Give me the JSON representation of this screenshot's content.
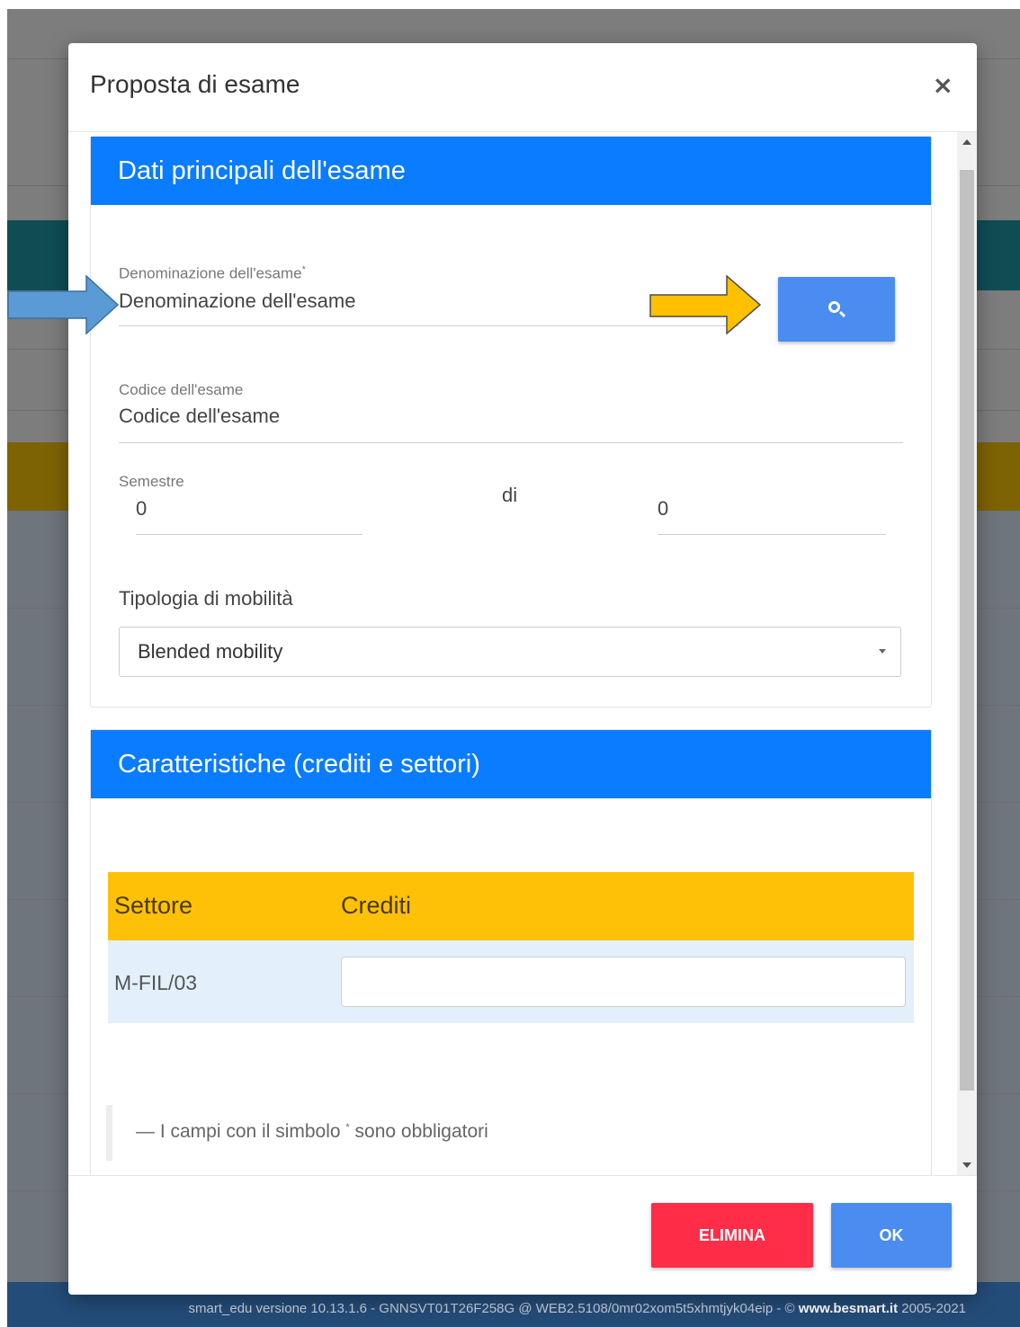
{
  "dialog": {
    "title": "Proposta di esame",
    "close_symbol": "×"
  },
  "section_main": {
    "title": "Dati principali dell'esame",
    "exam_name": {
      "label": "Denominazione dell'esame",
      "required_mark": "*",
      "placeholder": "Denominazione dell'esame"
    },
    "exam_code": {
      "label": "Codice dell'esame",
      "placeholder": "Codice dell'esame"
    },
    "semester": {
      "label": "Semestre",
      "value": "0",
      "separator": "di",
      "total": "0"
    },
    "mobility": {
      "label": "Tipologia di mobilità",
      "selected": "Blended mobility"
    }
  },
  "section_features": {
    "title": "Caratteristiche (crediti e settori)",
    "table": {
      "columns": [
        "Settore",
        "Crediti"
      ],
      "rows": [
        {
          "sector": "M-FIL/03",
          "credits": ""
        }
      ]
    }
  },
  "note": {
    "prefix": "— I campi con il simbolo",
    "symbol": "*",
    "suffix": "sono obbligatori"
  },
  "footer_buttons": {
    "delete_label": "ELIMINA",
    "ok_label": "OK"
  },
  "page_footer": {
    "text": "smart_edu versione 10.13.1.6 - GNNSVT01T26F258G @ WEB2.5108/0mr02xom5t5xhmtjyk04eip - ©",
    "link": "www.besmart.it",
    "years": "2005-2021"
  },
  "colors": {
    "section_header": "#0a7cff",
    "table_header": "#ffc107",
    "table_row": "#e3f0fb",
    "search_button": "#4a8cf0",
    "delete_button": "#ff2d47",
    "ok_button": "#4a8cf0",
    "arrow_blue": "#5b9bd5",
    "arrow_gold": "#ffc000"
  }
}
